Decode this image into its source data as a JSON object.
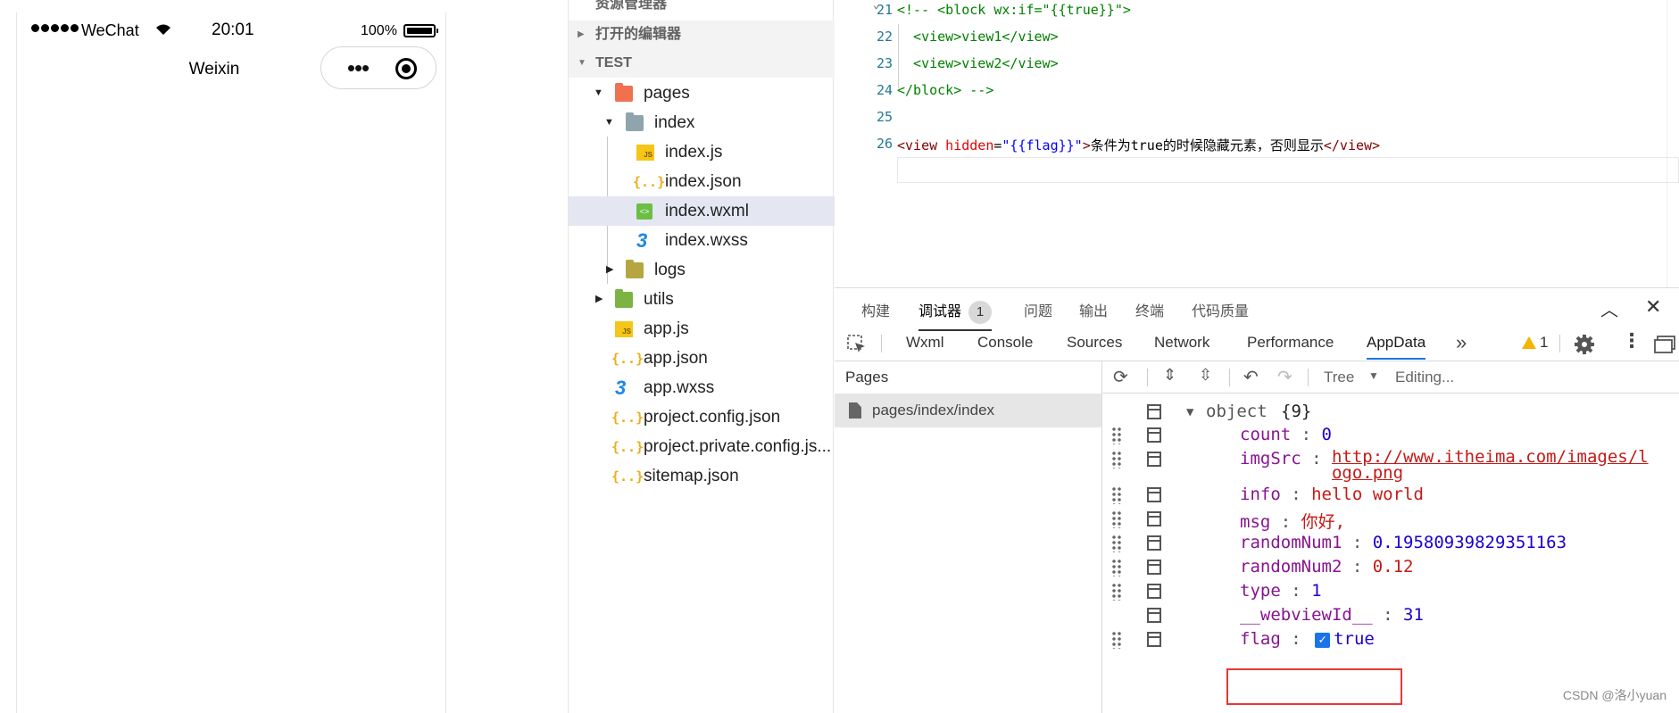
{
  "simulator": {
    "carrier": "WeChat",
    "time": "20:01",
    "battery": "100%",
    "nav_title": "Weixin",
    "capsule_more": "•••"
  },
  "explorer": {
    "partial_top": "资源管理器",
    "open_editors": "打开的编辑器",
    "project": "TEST",
    "items": [
      {
        "label": "pages",
        "icon": "folder-red-icon"
      },
      {
        "label": "index",
        "icon": "folder-icon"
      },
      {
        "label": "index.js",
        "icon": "js-file-icon"
      },
      {
        "label": "index.json",
        "icon": "json-file-icon"
      },
      {
        "label": "index.wxml",
        "icon": "wxml-file-icon"
      },
      {
        "label": "index.wxss",
        "icon": "wxss-file-icon"
      },
      {
        "label": "logs",
        "icon": "folder-icon"
      },
      {
        "label": "utils",
        "icon": "folder-icon"
      },
      {
        "label": "app.js",
        "icon": "js-file-icon"
      },
      {
        "label": "app.json",
        "icon": "json-file-icon"
      },
      {
        "label": "app.wxss",
        "icon": "wxss-file-icon"
      },
      {
        "label": "project.config.json",
        "icon": "json-file-icon"
      },
      {
        "label": "project.private.config.js...",
        "icon": "json-file-icon"
      },
      {
        "label": "sitemap.json",
        "icon": "json-file-icon"
      }
    ]
  },
  "editor": {
    "lines": [
      {
        "n": "21",
        "parts": [
          {
            "t": "<!-- <block wx:if=\"{{true}}\">",
            "c": "c-cmt"
          }
        ]
      },
      {
        "n": "22",
        "parts": [
          {
            "t": "  <view>view1</view>",
            "c": "c-cmt"
          }
        ]
      },
      {
        "n": "23",
        "parts": [
          {
            "t": "  <view>view2</view>",
            "c": "c-cmt"
          }
        ]
      },
      {
        "n": "24",
        "parts": [
          {
            "t": "</block> -->",
            "c": "c-cmt"
          }
        ]
      },
      {
        "n": "25",
        "parts": []
      },
      {
        "n": "26",
        "parts": [
          {
            "t": "<view",
            "c": "c-tag"
          },
          {
            "t": " hidden",
            "c": "c-attr"
          },
          {
            "t": "=",
            "c": "c-pl"
          },
          {
            "t": "\"{{flag}}\"",
            "c": "c-str"
          },
          {
            "t": ">",
            "c": "c-tag"
          },
          {
            "t": "条件为true的时候隐藏元素，否则显示",
            "c": "c-pl"
          },
          {
            "t": "</view>",
            "c": "c-tag"
          }
        ]
      }
    ]
  },
  "panel": {
    "tabs": [
      "构建",
      "调试器",
      "问题",
      "输出",
      "终端",
      "代码质量"
    ],
    "debugger_badge": "1",
    "devtool_tabs": [
      "Wxml",
      "Console",
      "Sources",
      "Network",
      "Performance",
      "AppData"
    ],
    "active_devtool_tab": "AppData",
    "warning_count": "1",
    "pages_header": "Pages",
    "pages": [
      "pages/index/index"
    ],
    "view_mode": "Tree",
    "editing": "Editing...",
    "root": {
      "key": "object",
      "value": "{9}"
    },
    "data": [
      {
        "key": "count",
        "value": "0",
        "type": "v-num"
      },
      {
        "key": "imgSrc",
        "value": "http://www.itheima.com/images/logo.png",
        "type": "link"
      },
      {
        "key": "info",
        "value": "hello world",
        "type": "v-str"
      },
      {
        "key": "msg",
        "value": "你好,",
        "type": "v-str"
      },
      {
        "key": "randomNum1",
        "value": "0.19580939829351163",
        "type": "v-num"
      },
      {
        "key": "randomNum2",
        "value": "0.12",
        "type": "v-str"
      },
      {
        "key": "type",
        "value": "1",
        "type": "v-num"
      },
      {
        "key": "__webviewId__",
        "value": "31",
        "type": "v-num"
      },
      {
        "key": "flag",
        "value": "true",
        "type": "checkbox"
      }
    ]
  },
  "watermark": "CSDN @洛小yuan",
  "colors": {
    "accent": "#1a73e8",
    "highlight_box": "#e53935",
    "warning": "#f4b400"
  }
}
